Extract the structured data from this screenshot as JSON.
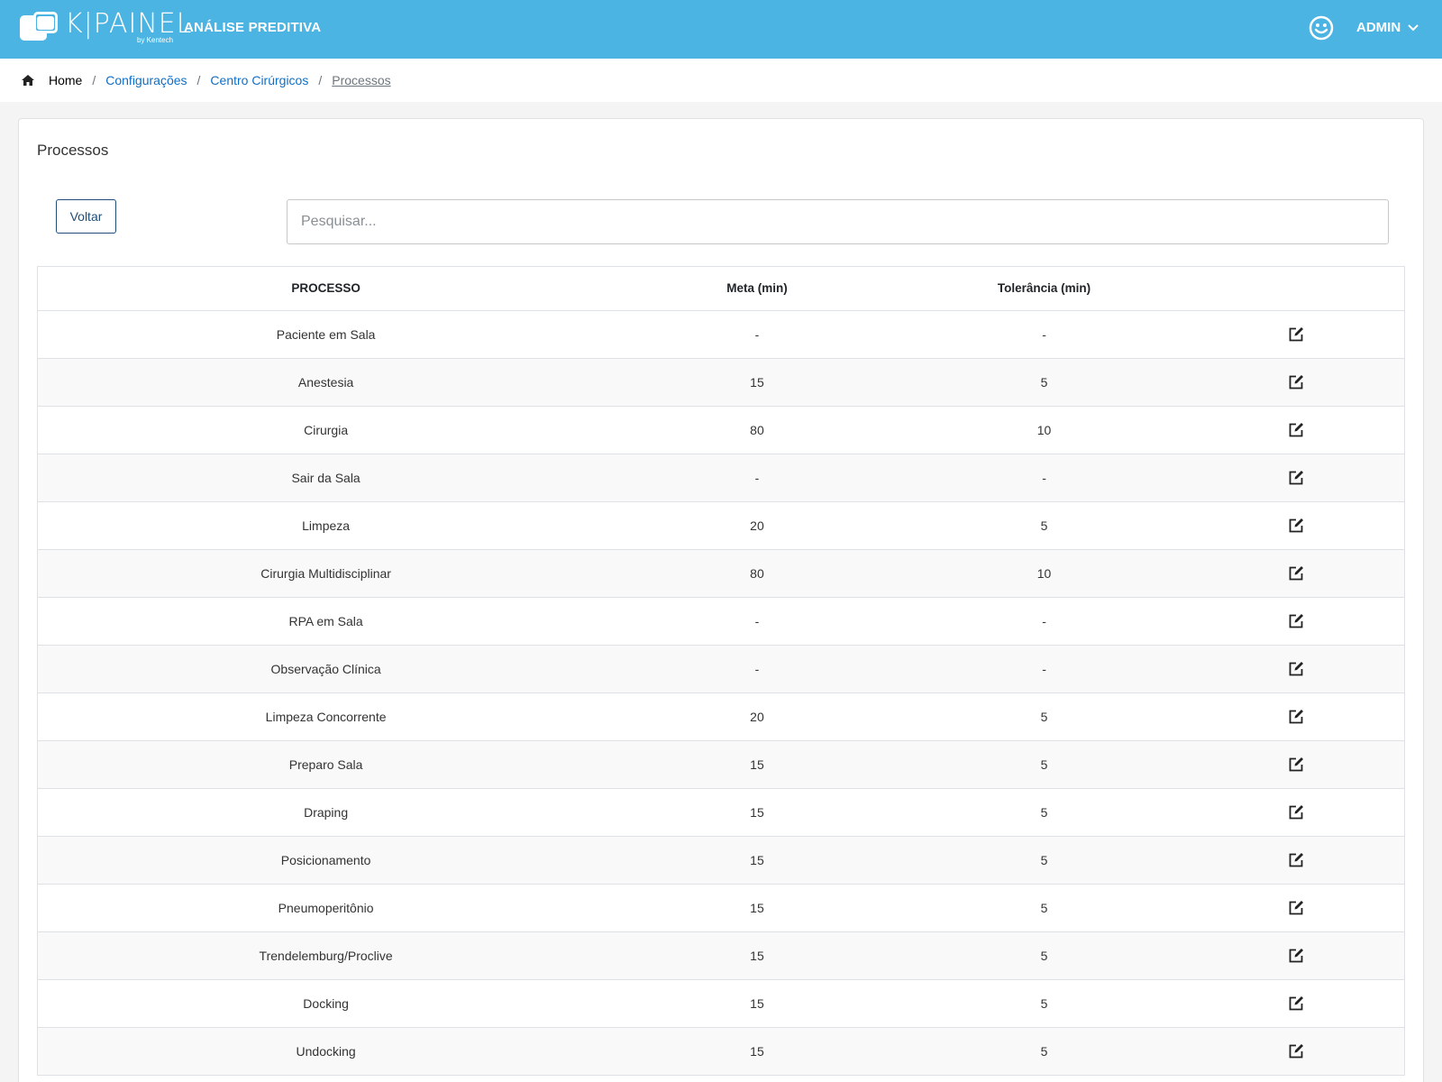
{
  "header": {
    "logo_text": "K|PAINEL",
    "logo_sub": "by Kentech",
    "app_title": "ANÁLISE PREDITIVA",
    "user_label": "ADMIN",
    "icons": [
      "smiley-icon",
      "chevron-down-icon"
    ],
    "background_color": "#4bb4e2"
  },
  "breadcrumb": {
    "items": [
      "Home",
      "Configurações",
      "Centro Cirúrgicos",
      "Processos"
    ],
    "separator": "/"
  },
  "card": {
    "title": "Processos",
    "back_label": "Voltar",
    "search_placeholder": "Pesquisar..."
  },
  "table": {
    "headers": [
      "PROCESSO",
      "Meta (min)",
      "Tolerância (min)",
      ""
    ],
    "rows": [
      {
        "processo": "Paciente em Sala",
        "meta": "-",
        "tolerancia": "-"
      },
      {
        "processo": "Anestesia",
        "meta": "15",
        "tolerancia": "5"
      },
      {
        "processo": "Cirurgia",
        "meta": "80",
        "tolerancia": "10"
      },
      {
        "processo": "Sair da Sala",
        "meta": "-",
        "tolerancia": "-"
      },
      {
        "processo": "Limpeza",
        "meta": "20",
        "tolerancia": "5"
      },
      {
        "processo": "Cirurgia Multidisciplinar",
        "meta": "80",
        "tolerancia": "10"
      },
      {
        "processo": "RPA em Sala",
        "meta": "-",
        "tolerancia": "-"
      },
      {
        "processo": "Observação Clínica",
        "meta": "-",
        "tolerancia": "-"
      },
      {
        "processo": "Limpeza Concorrente",
        "meta": "20",
        "tolerancia": "5"
      },
      {
        "processo": "Preparo Sala",
        "meta": "15",
        "tolerancia": "5"
      },
      {
        "processo": "Draping",
        "meta": "15",
        "tolerancia": "5"
      },
      {
        "processo": "Posicionamento",
        "meta": "15",
        "tolerancia": "5"
      },
      {
        "processo": "Pneumoperitônio",
        "meta": "15",
        "tolerancia": "5"
      },
      {
        "processo": "Trendelemburg/Proclive",
        "meta": "15",
        "tolerancia": "5"
      },
      {
        "processo": "Docking",
        "meta": "15",
        "tolerancia": "5"
      },
      {
        "processo": "Undocking",
        "meta": "15",
        "tolerancia": "5"
      }
    ]
  }
}
